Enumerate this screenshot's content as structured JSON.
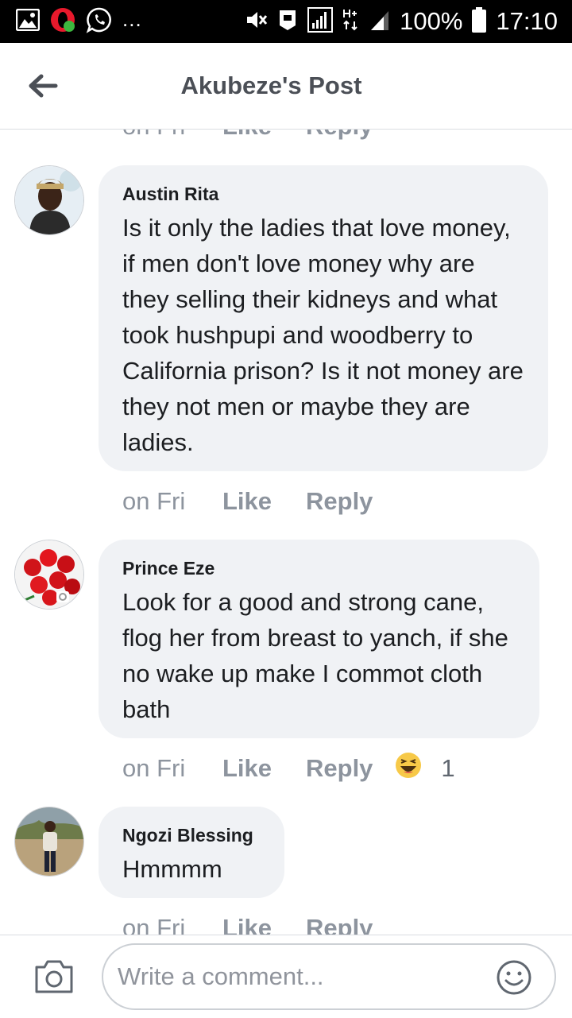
{
  "status_bar": {
    "battery_percent": "100%",
    "time": "17:10",
    "overflow": "..."
  },
  "header": {
    "title": "Akubeze's Post"
  },
  "comments": [
    {
      "time": "on Fri",
      "like": "Like",
      "reply": "Reply"
    },
    {
      "author": "Austin Rita",
      "text": "Is it only the ladies that love money, if men don't love money why are they selling their kidneys and what took hushpupi and woodberry to California prison? Is it not money are they not men or maybe they are ladies.",
      "time": "on Fri",
      "like": "Like",
      "reply": "Reply"
    },
    {
      "author": "Prince Eze",
      "text": "Look for a good and strong cane, flog her from breast to yanch, if she no wake up make I commot cloth bath",
      "time": "on Fri",
      "like": "Like",
      "reply": "Reply",
      "reaction": {
        "icon": "haha-emoji-icon",
        "count": "1"
      }
    },
    {
      "author": "Ngozi Blessing",
      "text": "Hmmmm",
      "time": "on Fri",
      "like": "Like",
      "reply": "Reply"
    }
  ],
  "composer": {
    "placeholder": "Write a comment..."
  },
  "colors": {
    "bubble": "#f0f2f5",
    "action_text": "#8d949e",
    "title_text": "#4b4f56"
  }
}
